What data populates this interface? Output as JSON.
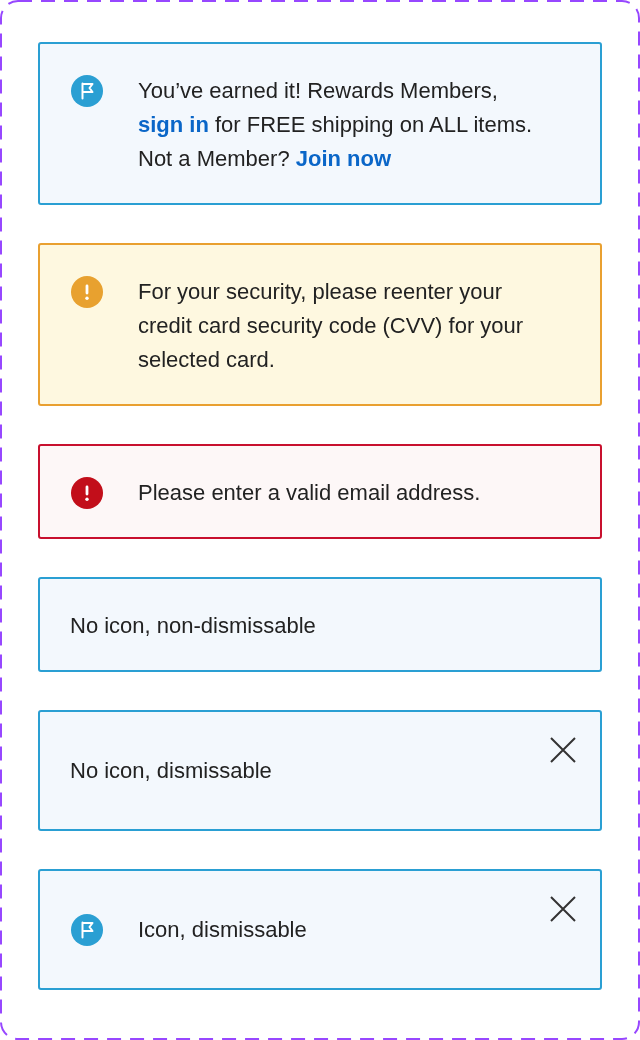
{
  "alerts": [
    {
      "kind": "info",
      "has_icon": true,
      "dismissable": false,
      "message": [
        {
          "kind": "text",
          "text": "You’ve earned it! Rewards Members, "
        },
        {
          "kind": "link",
          "text": "sign in"
        },
        {
          "kind": "text",
          "text": " for FREE shipping on ALL items. Not a Member? "
        },
        {
          "kind": "link",
          "text": "Join now"
        }
      ]
    },
    {
      "kind": "warning",
      "has_icon": true,
      "dismissable": false,
      "message": [
        {
          "kind": "text",
          "text": "For your security, please reenter your credit card security code (CVV) for your selected card."
        }
      ]
    },
    {
      "kind": "error",
      "has_icon": true,
      "dismissable": false,
      "message": [
        {
          "kind": "text",
          "text": "Please enter a valid email address."
        }
      ]
    },
    {
      "kind": "info",
      "has_icon": false,
      "dismissable": false,
      "message": [
        {
          "kind": "text",
          "text": "No icon, non-dismissable"
        }
      ]
    },
    {
      "kind": "info",
      "has_icon": false,
      "dismissable": true,
      "message": [
        {
          "kind": "text",
          "text": "No icon, dismissable"
        }
      ]
    },
    {
      "kind": "info",
      "has_icon": true,
      "dismissable": true,
      "message": [
        {
          "kind": "text",
          "text": "Icon, dismissable"
        }
      ]
    }
  ]
}
